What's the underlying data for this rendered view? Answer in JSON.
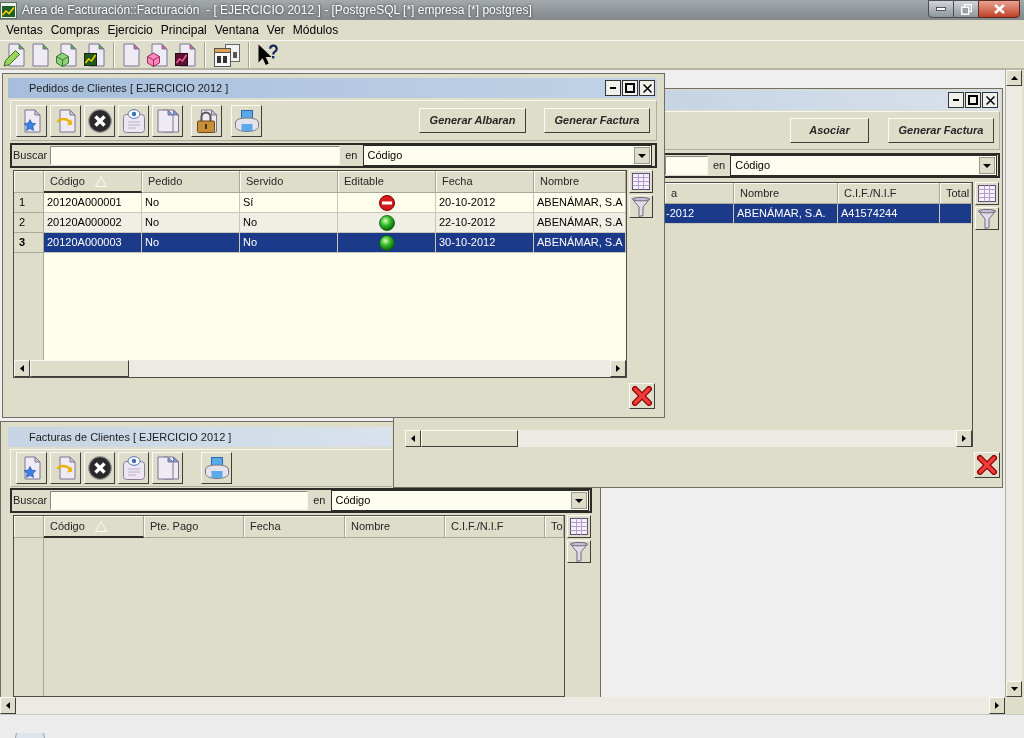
{
  "window": {
    "title": "Area de Facturación::Facturación  - [ EJERCICIO 2012 ] - [PostgreSQL [*] empresa [*] postgres]"
  },
  "menu": [
    "Ventas",
    "Compras",
    "Ejercicio",
    "Principal",
    "Ventana",
    "Ver",
    "Módulos"
  ],
  "pedidos_window": {
    "title": "Pedidos de Clientes [ EJERCICIO 2012 ]",
    "active": true,
    "buttons": [
      "Generar Albaran",
      "Generar Factura"
    ],
    "search": {
      "label": "Buscar",
      "in_label": "en",
      "field": "Código"
    },
    "table": {
      "columns": [
        {
          "label": "Código",
          "kind": "text",
          "sorted": true
        },
        {
          "label": "Pedido",
          "kind": "text",
          "sorted": false
        },
        {
          "label": "Servido",
          "kind": "text",
          "sorted": false
        },
        {
          "label": "Editable",
          "kind": "status",
          "sorted": false
        },
        {
          "label": "Fecha",
          "kind": "text",
          "sorted": false
        },
        {
          "label": "Nombre",
          "kind": "text",
          "sorted": false
        }
      ],
      "rows": [
        {
          "number": "1",
          "selected": false,
          "cells": [
            "20120A000001",
            "No",
            "Sí",
            false,
            "20-10-2012",
            "ABENÁMAR, S.A"
          ]
        },
        {
          "number": "2",
          "selected": false,
          "cells": [
            "20120A000002",
            "No",
            "No",
            true,
            "22-10-2012",
            "ABENÁMAR, S.A"
          ]
        },
        {
          "number": "3",
          "selected": true,
          "cells": [
            "20120A000003",
            "No",
            "No",
            true,
            "30-10-2012",
            "ABENÁMAR, S.A"
          ]
        }
      ]
    }
  },
  "covered_window": {
    "active": false,
    "buttons": [
      "Asociar",
      "Generar Factura"
    ],
    "search": {
      "in_label": "en",
      "field": "Código"
    },
    "table": {
      "columns": [
        {
          "label": "a"
        },
        {
          "label": "Nombre"
        },
        {
          "label": "C.I.F./N.I.F"
        },
        {
          "label": "Total"
        }
      ],
      "rows": [
        {
          "selected": true,
          "cells": [
            "-2012",
            "ABENÁMAR, S.A.",
            "A41574244"
          ]
        }
      ]
    }
  },
  "facturas_window": {
    "title": "Facturas de Clientes [ EJERCICIO 2012 ]",
    "active": false,
    "search": {
      "label": "Buscar",
      "in_label": "en",
      "field": "Código"
    },
    "table": {
      "columns": [
        {
          "label": "Código",
          "sorted": true
        },
        {
          "label": "Pte. Pago",
          "sorted": false
        },
        {
          "label": "Fecha",
          "sorted": false
        },
        {
          "label": "Nombre",
          "sorted": false
        },
        {
          "label": "C.I.F./N.I.F",
          "sorted": false
        },
        {
          "label": "To",
          "sorted": false
        }
      ]
    }
  }
}
